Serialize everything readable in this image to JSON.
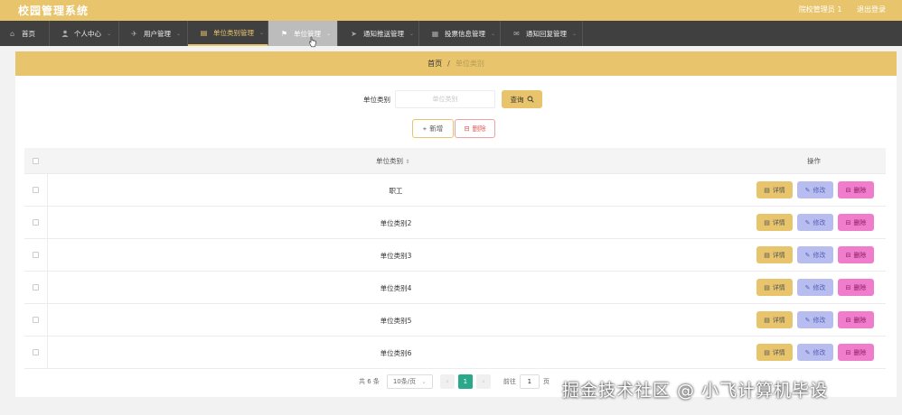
{
  "header": {
    "title": "校园管理系统",
    "user": "院校管理员 1",
    "logout": "退出登录"
  },
  "nav": [
    {
      "label": "首页",
      "icon": "home-icon"
    },
    {
      "label": "个人中心",
      "icon": "user-icon"
    },
    {
      "label": "用户管理",
      "icon": "users-icon"
    },
    {
      "label": "单位类别管理",
      "icon": "category-icon"
    },
    {
      "label": "单位管理",
      "icon": "flag-icon"
    },
    {
      "label": "通知推送管理",
      "icon": "send-icon"
    },
    {
      "label": "投票信息管理",
      "icon": "grid-icon"
    },
    {
      "label": "通知回复管理",
      "icon": "mail-icon"
    }
  ],
  "breadcrumb": {
    "home": "首页",
    "separator": "/",
    "current": "单位类别"
  },
  "search": {
    "label": "单位类别",
    "placeholder": "单位类别",
    "button": "查询"
  },
  "actions": {
    "add": "新增",
    "delete": "删除"
  },
  "table": {
    "columns": {
      "name": "单位类别",
      "ops": "操作"
    },
    "rows": [
      {
        "name": "职工"
      },
      {
        "name": "单位类别2"
      },
      {
        "name": "单位类别3"
      },
      {
        "name": "单位类别4"
      },
      {
        "name": "单位类别5"
      },
      {
        "name": "单位类别6"
      }
    ],
    "row_actions": {
      "detail": "详情",
      "edit": "修改",
      "remove": "删除"
    }
  },
  "pagination": {
    "total": "共 6 条",
    "page_size": "10条/页",
    "current_page": "1",
    "goto_label": "前往",
    "goto_value": "1",
    "page_unit": "页"
  },
  "watermark": "掘金技术社区 @ 小飞计算机毕设",
  "colors": {
    "accent": "#e8c56c",
    "nav_bg": "#404040",
    "edit": "#b8bdf0",
    "remove": "#f07ccc",
    "active_page": "#29a88a"
  }
}
